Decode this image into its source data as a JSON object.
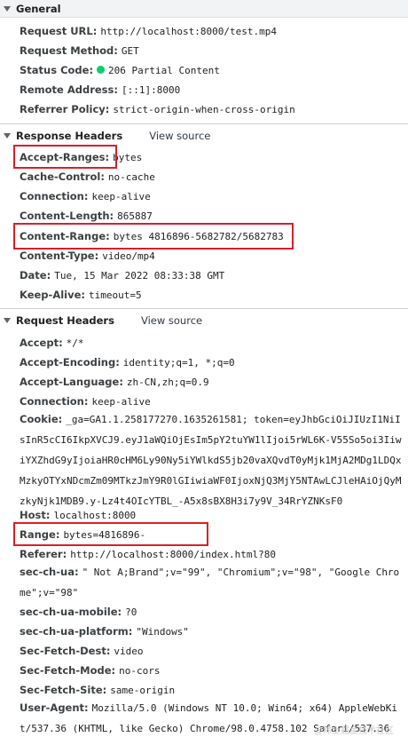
{
  "general": {
    "title": "General",
    "request_url_label": "Request URL:",
    "request_url": "http://localhost:8000/test.mp4",
    "request_method_label": "Request Method:",
    "request_method": "GET",
    "status_code_label": "Status Code:",
    "status_code": "206 Partial Content",
    "remote_address_label": "Remote Address:",
    "remote_address": "[::1]:8000",
    "referrer_policy_label": "Referrer Policy:",
    "referrer_policy": "strict-origin-when-cross-origin"
  },
  "response_headers": {
    "title": "Response Headers",
    "view_source": "View source",
    "accept_ranges_label": "Accept-Ranges:",
    "accept_ranges": "bytes",
    "cache_control_label": "Cache-Control:",
    "cache_control": "no-cache",
    "connection_label": "Connection:",
    "connection": "keep-alive",
    "content_length_label": "Content-Length:",
    "content_length": "865887",
    "content_range_label": "Content-Range:",
    "content_range": "bytes 4816896-5682782/5682783",
    "content_type_label": "Content-Type:",
    "content_type": "video/mp4",
    "date_label": "Date:",
    "date": "Tue, 15 Mar 2022 08:33:38 GMT",
    "keep_alive_label": "Keep-Alive:",
    "keep_alive": "timeout=5"
  },
  "request_headers": {
    "title": "Request Headers",
    "view_source": "View source",
    "accept_label": "Accept:",
    "accept": "*/*",
    "accept_encoding_label": "Accept-Encoding:",
    "accept_encoding": "identity;q=1, *;q=0",
    "accept_language_label": "Accept-Language:",
    "accept_language": "zh-CN,zh;q=0.9",
    "connection_label": "Connection:",
    "connection": "keep-alive",
    "cookie_label": "Cookie:",
    "cookie": "_ga=GA1.1.258177270.1635261581; token=eyJhbGciOiJIUzI1NiIsInR5cCI6IkpXVCJ9.eyJ1aWQiOjEsIm5pY2tuYW1lIjoi5rWL6K-V55So5oi3IiwiYXZhdG9yIjoiaHR0cHM6Ly90Ny5iYWlkdS5jb20vaXQvdT0yMjk1MjA2MDg1LDQxMzkyOTYxNDcmZm09MTkzJmY9R0lGIiwiaWF0IjoxNjQ3MjY5NTAwLCJleHAiOjQyMzkyNjk1MDB9.y-Lz4t4OIcYTBL_-A5x8sBX8H3i7y9V_34RrYZNKsF0",
    "host_label": "Host:",
    "host": "localhost:8000",
    "range_label": "Range:",
    "range": "bytes=4816896-",
    "referer_label": "Referer:",
    "referer": "http://localhost:8000/index.html?80",
    "sec_ch_ua_label": "sec-ch-ua:",
    "sec_ch_ua": "\" Not A;Brand\";v=\"99\", \"Chromium\";v=\"98\", \"Google Chrome\";v=\"98\"",
    "sec_ch_ua_mobile_label": "sec-ch-ua-mobile:",
    "sec_ch_ua_mobile": "?0",
    "sec_ch_ua_platform_label": "sec-ch-ua-platform:",
    "sec_ch_ua_platform": "\"Windows\"",
    "sec_fetch_dest_label": "Sec-Fetch-Dest:",
    "sec_fetch_dest": "video",
    "sec_fetch_mode_label": "Sec-Fetch-Mode:",
    "sec_fetch_mode": "no-cors",
    "sec_fetch_site_label": "Sec-Fetch-Site:",
    "sec_fetch_site": "same-origin",
    "user_agent_label": "User-Agent:",
    "user_agent": "Mozilla/5.0 (Windows NT 10.0; Win64; x64) AppleWebKit/537.36 (KHTML, like Gecko) Chrome/98.0.4758.102 Safari/537.36"
  },
  "colors": {
    "status_dot": "#0cce6b",
    "highlight_box": "#d91e2a"
  },
  "watermark": "@稀土掘金技术社区"
}
